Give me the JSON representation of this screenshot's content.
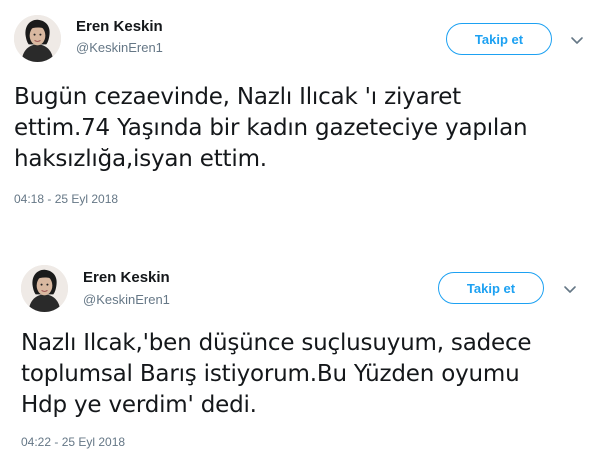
{
  "tweets": [
    {
      "author_name": "Eren Keskin",
      "author_handle": "@KeskinEren1",
      "follow_label": "Takip et",
      "text_lines": [
        "Bugün cezaevinde, Nazlı Ilıcak 'ı ziyaret",
        "ettim.74 Yaşında bir kadın gazeteciye yapılan",
        "haksızlığa,isyan ettim."
      ],
      "timestamp": "04:18 - 25 Eyl 2018"
    },
    {
      "author_name": "Eren Keskin",
      "author_handle": "@KeskinEren1",
      "follow_label": "Takip et",
      "text_lines": [
        "Nazlı Ilcak,'ben düşünce suçlusuyum, sadece",
        "toplumsal Barış istiyorum.Bu Yüzden oyumu",
        "Hdp ye verdim' dedi."
      ],
      "timestamp": "04:22 - 25 Eyl 2018"
    }
  ],
  "icons": {
    "avatar": "avatar",
    "menu": "chevron-down-icon"
  },
  "colors": {
    "accent": "#1da1f2",
    "secondary_text": "#657786",
    "primary_text": "#14171a"
  }
}
